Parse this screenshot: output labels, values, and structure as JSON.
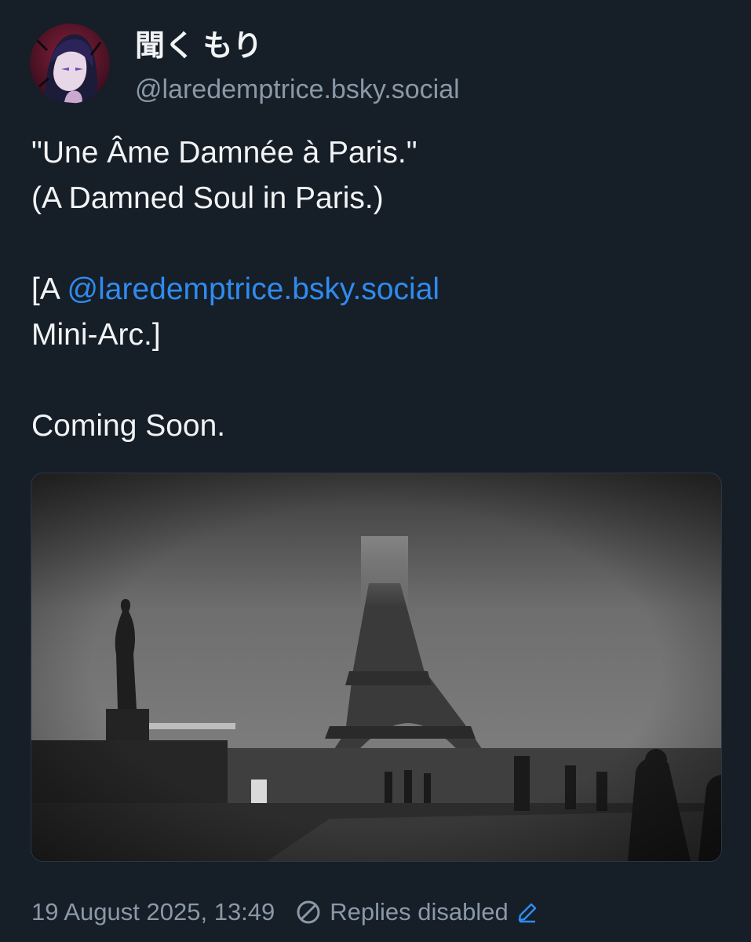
{
  "author": {
    "display_name": "聞く もり",
    "handle": "@laredemptrice.bsky.social"
  },
  "post": {
    "lines": [
      "\"Une Âme Damnée à Paris.\"",
      "(A Damned Soul in Paris.)"
    ],
    "mention_prefix": "[A ",
    "mention": "@laredemptrice.bsky.social",
    "mention_suffix": "Mini-Arc.]",
    "closing": "Coming Soon."
  },
  "media": {
    "icon": "photo-eiffel-tower-fog"
  },
  "meta": {
    "timestamp": "19 August 2025, 13:49",
    "replies_status": "Replies disabled",
    "icons": [
      "ban-icon",
      "pencil-icon"
    ]
  },
  "colors": {
    "background": "#161e27",
    "text": "#f1f3f5",
    "muted": "#8a98a8",
    "accent": "#2f8bef"
  }
}
